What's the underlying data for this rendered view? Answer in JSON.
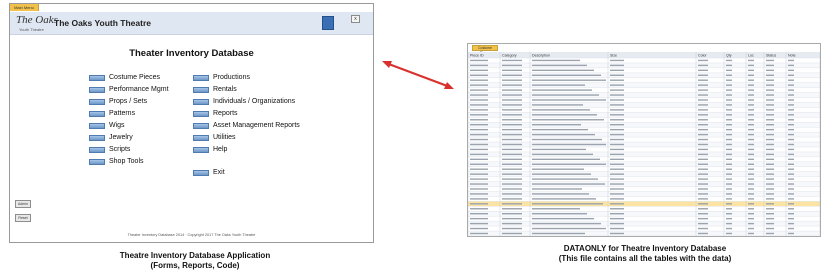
{
  "app_window": {
    "tab_label": "Main Menu",
    "logo_text": "The Oaks",
    "logo_subtext": "Youth Theatre",
    "app_name": "The Oaks Youth Theatre",
    "corner_button": "x",
    "db_title": "Theater Inventory Database",
    "menu_left": [
      "Costume Pieces",
      "Performance Mgmt",
      "Props / Sets",
      "Patterns",
      "Wigs",
      "Jewelry",
      "Scripts",
      "Shop Tools"
    ],
    "menu_right": [
      "Productions",
      "Rentals",
      "Individuals / Organizations",
      "Reports",
      "Asset Management Reports",
      "Utilities",
      "Help"
    ],
    "exit_label": "Exit",
    "side_buttons": [
      "Admin",
      "Reset"
    ],
    "footer": "Theater Inventory Database 2014 · Copyright 2017 The Oaks Youth Theatre"
  },
  "captions": {
    "left_line1": "Theatre Inventory Database Application",
    "left_line2": "(Forms, Reports, Code)",
    "right_line1": "DATAONLY for Theatre Inventory Database",
    "right_line2": "(This file contains all the tables with the data)"
  },
  "datasheet": {
    "tab_label": "Costume Pieces",
    "columns": [
      "Piece ID",
      "Category",
      "Description",
      "Size",
      "Color",
      "Qty",
      "Loc",
      "Status",
      "Note"
    ],
    "row_count": 36,
    "selected_row": 29
  },
  "colors": {
    "arrow": "#d9322e",
    "menu_button": "#6d97c8",
    "tab_accent": "#f2c14a"
  }
}
